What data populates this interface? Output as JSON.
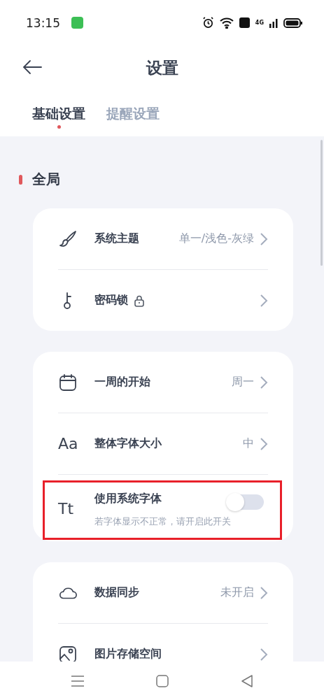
{
  "status_bar": {
    "time": "13:15",
    "network": "4G"
  },
  "header": {
    "title": "设置"
  },
  "tabs": [
    {
      "label": "基础设置",
      "selected": true
    },
    {
      "label": "提醒设置",
      "selected": false
    }
  ],
  "section": {
    "title": "全局"
  },
  "cards": [
    {
      "rows": [
        {
          "kind": "link",
          "label": "系统主题",
          "value": "单一/浅色-灰绿",
          "locked": false
        },
        {
          "kind": "link",
          "label": "密码锁",
          "locked": true
        }
      ]
    },
    {
      "rows": [
        {
          "kind": "link",
          "label": "一周的开始",
          "value": "周一",
          "locked": false
        },
        {
          "kind": "link",
          "icon_text": "Aa",
          "label": "整体字体大小",
          "value": "中",
          "locked": false
        },
        {
          "kind": "toggle",
          "icon_text": "Tt",
          "label": "使用系统字体",
          "subtitle": "若字体显示不正常，请开启此开关",
          "on": false,
          "highlighted": true
        }
      ]
    },
    {
      "rows": [
        {
          "kind": "link",
          "label": "数据同步",
          "value": "未开启",
          "locked": false
        },
        {
          "kind": "link",
          "label": "图片存储空间",
          "locked": false
        }
      ]
    }
  ]
}
